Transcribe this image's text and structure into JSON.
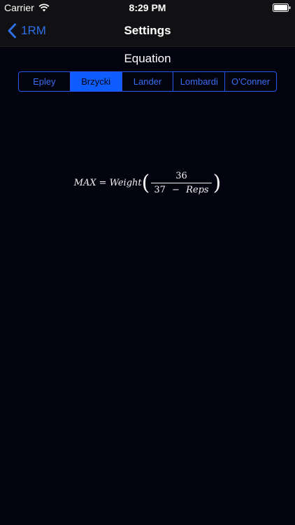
{
  "status_bar": {
    "carrier": "Carrier",
    "time": "8:29 PM"
  },
  "nav": {
    "back_label": "1RM",
    "title": "Settings"
  },
  "equation_section": {
    "label": "Equation",
    "options": [
      "Epley",
      "Brzycki",
      "Lander",
      "Lombardi",
      "O'Conner"
    ],
    "selected": "Brzycki"
  },
  "formula": {
    "lhs": "MAX",
    "equals": "=",
    "weight": "Weight",
    "numerator": "36",
    "denominator_constant": "37",
    "minus": "−",
    "denominator_variable": "Reps"
  },
  "colors": {
    "background": "#03030f",
    "bar": "#111114",
    "accent": "#2f6fe6",
    "segment_selected": "#0f5cff"
  }
}
